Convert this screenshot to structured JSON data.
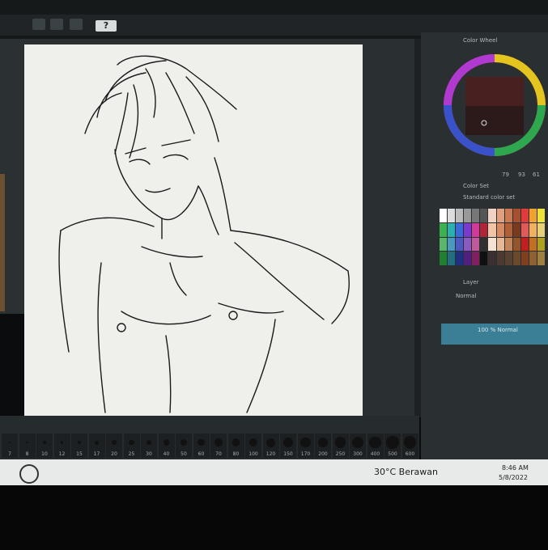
{
  "toolbar": {
    "help_label": "?"
  },
  "color_wheel": {
    "title": "Color Wheel",
    "values": [
      "79",
      "93",
      "61"
    ]
  },
  "color_set": {
    "title": "Color Set",
    "name": "Standard color set"
  },
  "layer_panel": {
    "title": "Layer",
    "blend_mode": "Normal",
    "layer_name": "100 % Normal"
  },
  "brush_sizes": [
    "7",
    "8",
    "10",
    "12",
    "15",
    "17",
    "20",
    "25",
    "30",
    "40",
    "50",
    "60",
    "70",
    "80",
    "100",
    "120",
    "150",
    "170",
    "200",
    "250",
    "300",
    "400",
    "500",
    "600"
  ],
  "taskbar": {
    "weather": "30°C Berawan",
    "time": "8:46 AM",
    "date": "5/8/2022"
  }
}
